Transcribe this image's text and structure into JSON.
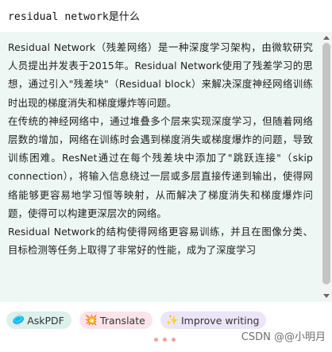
{
  "query": "residual network是什么",
  "answer": {
    "paragraphs": [
      "Residual Network（残差网络）是一种深度学习架构，由微软研究人员提出并发表于2015年。Residual Network使用了残差学习的思想，通过引入\"残差块\"（Residual block）来解决深度神经网络训练时出现的梯度消失和梯度爆炸等问题。",
      "在传统的神经网络中，通过堆叠多个层来实现深度学习，但随着网络层数的增加，网络在训练时会遇到梯度消失或梯度爆炸的问题，导致训练困难。ResNet通过在每个残差块中添加了\"跳跃连接\"（skip connection），将输入信息绕过一层或多层直接传递到输出，使得网络能够更容易地学习恒等映射，从而解决了梯度消失和梯度爆炸问题，使得可以构建更深层次的网络。",
      "Residual Network的结构使得网络更容易训练，并且在图像分类、目标检测等任务上取得了非常好的性能，成为了深度学习"
    ]
  },
  "toolbar": {
    "askpdf": {
      "icon": "🥏",
      "label": "AskPDF"
    },
    "translate": {
      "icon": "💥",
      "label": "Translate"
    },
    "improve": {
      "icon": "✨",
      "label": "Improve writing"
    }
  },
  "watermark": "CSDN @@小明月",
  "colors": {
    "answer_bg": "#eef7f4",
    "askpdf_bg": "#dcf0ec",
    "translate_bg": "#fde4ea",
    "improve_bg": "#ece5f8",
    "dots": "#f2a0a0"
  }
}
